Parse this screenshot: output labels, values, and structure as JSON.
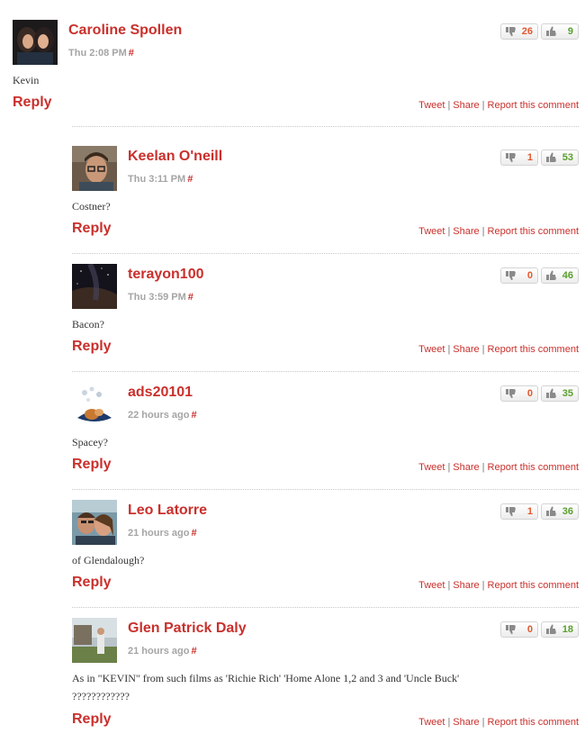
{
  "actions": {
    "tweet": "Tweet",
    "share": "Share",
    "report": "Report this comment",
    "separator": "|"
  },
  "reply_label": "Reply",
  "permalink": "#",
  "colors": {
    "accent": "#c9302c",
    "downvote": "#e4572e",
    "upvote": "#5aa02c",
    "meta": "#a5a5a5"
  },
  "comments": [
    {
      "author": "Caroline Spollen",
      "time": "Thu 2:08 PM",
      "down": "26",
      "up": "9",
      "text": [
        "Kevin"
      ],
      "avatar": "avatar-two-women-photo"
    },
    {
      "author": "Keelan O'neill",
      "time": "Thu 3:11 PM",
      "down": "1",
      "up": "53",
      "text": [
        "Costner?"
      ],
      "avatar": "avatar-man-with-glasses-photo"
    },
    {
      "author": "terayon100",
      "time": "Thu 3:59 PM",
      "down": "0",
      "up": "46",
      "text": [
        "Bacon?"
      ],
      "avatar": "avatar-night-sky-photo"
    },
    {
      "author": "ads20101",
      "time": "22 hours ago",
      "down": "0",
      "up": "35",
      "text": [
        "Spacey?"
      ],
      "avatar": "avatar-cartoon-drawing"
    },
    {
      "author": "Leo Latorre",
      "time": "21 hours ago",
      "down": "1",
      "up": "36",
      "text": [
        "of Glendalough?"
      ],
      "avatar": "avatar-couple-selfie-photo"
    },
    {
      "author": "Glen Patrick Daly",
      "time": "21 hours ago",
      "down": "0",
      "up": "18",
      "text": [
        "As in \"KEVIN\" from such films as 'Richie Rich' 'Home Alone 1,2 and 3 and 'Uncle Buck'",
        "????????????"
      ],
      "avatar": "avatar-person-outdoors-photo"
    }
  ]
}
